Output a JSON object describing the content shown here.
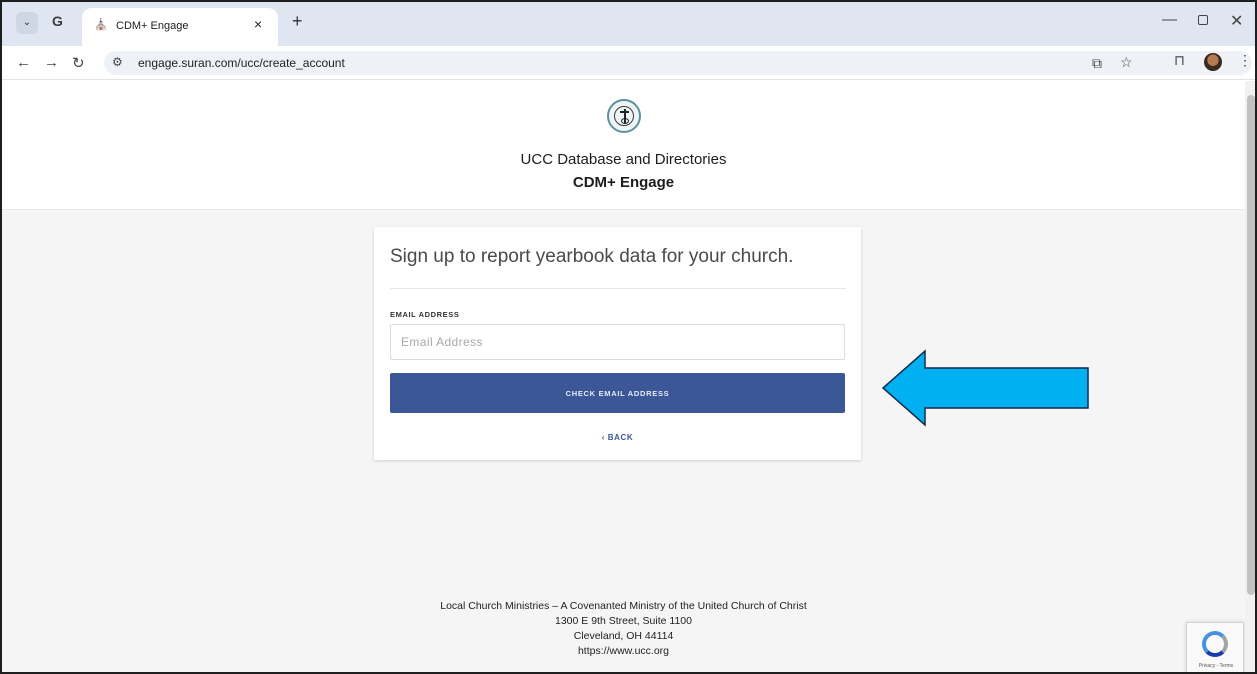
{
  "browser": {
    "tab_title": "CDM+ Engage",
    "tab_close": "×",
    "new_tab": "+",
    "url": "engage.suran.com/ucc/create_account",
    "icons": [
      "tab-search-icon",
      "google-icon",
      "back-icon",
      "forward-icon",
      "reload-icon",
      "site-info-icon",
      "install-app-icon",
      "bookmark-star-icon",
      "extensions-icon",
      "profile-avatar-icon",
      "menu-icon"
    ]
  },
  "header": {
    "org_name": "UCC Database and Directories",
    "app_name": "CDM+ Engage",
    "logo_icon": "ucc-seal-icon"
  },
  "signup": {
    "title": "Sign up to report yearbook data for your church.",
    "email_label": "EMAIL ADDRESS",
    "email_placeholder": "Email Address",
    "email_value": "",
    "check_button": "CHECK EMAIL ADDRESS",
    "back_link": "‹ BACK"
  },
  "annotation": {
    "arrow_color": "#00b0f0",
    "arrow_points_to": "check-email-button"
  },
  "footer": {
    "line1": "Local Church Ministries – A Covenanted Ministry of the United Church of Christ",
    "line2": "1300 E 9th Street, Suite 1100",
    "line3": "Cleveland, OH 44114",
    "line4": "https://www.ucc.org"
  },
  "recaptcha": {
    "text": "Privacy - Terms"
  },
  "colors": {
    "primary_button": "#3b5797",
    "page_background": "#f5f5f5",
    "tab_strip": "#dfe5f1"
  }
}
